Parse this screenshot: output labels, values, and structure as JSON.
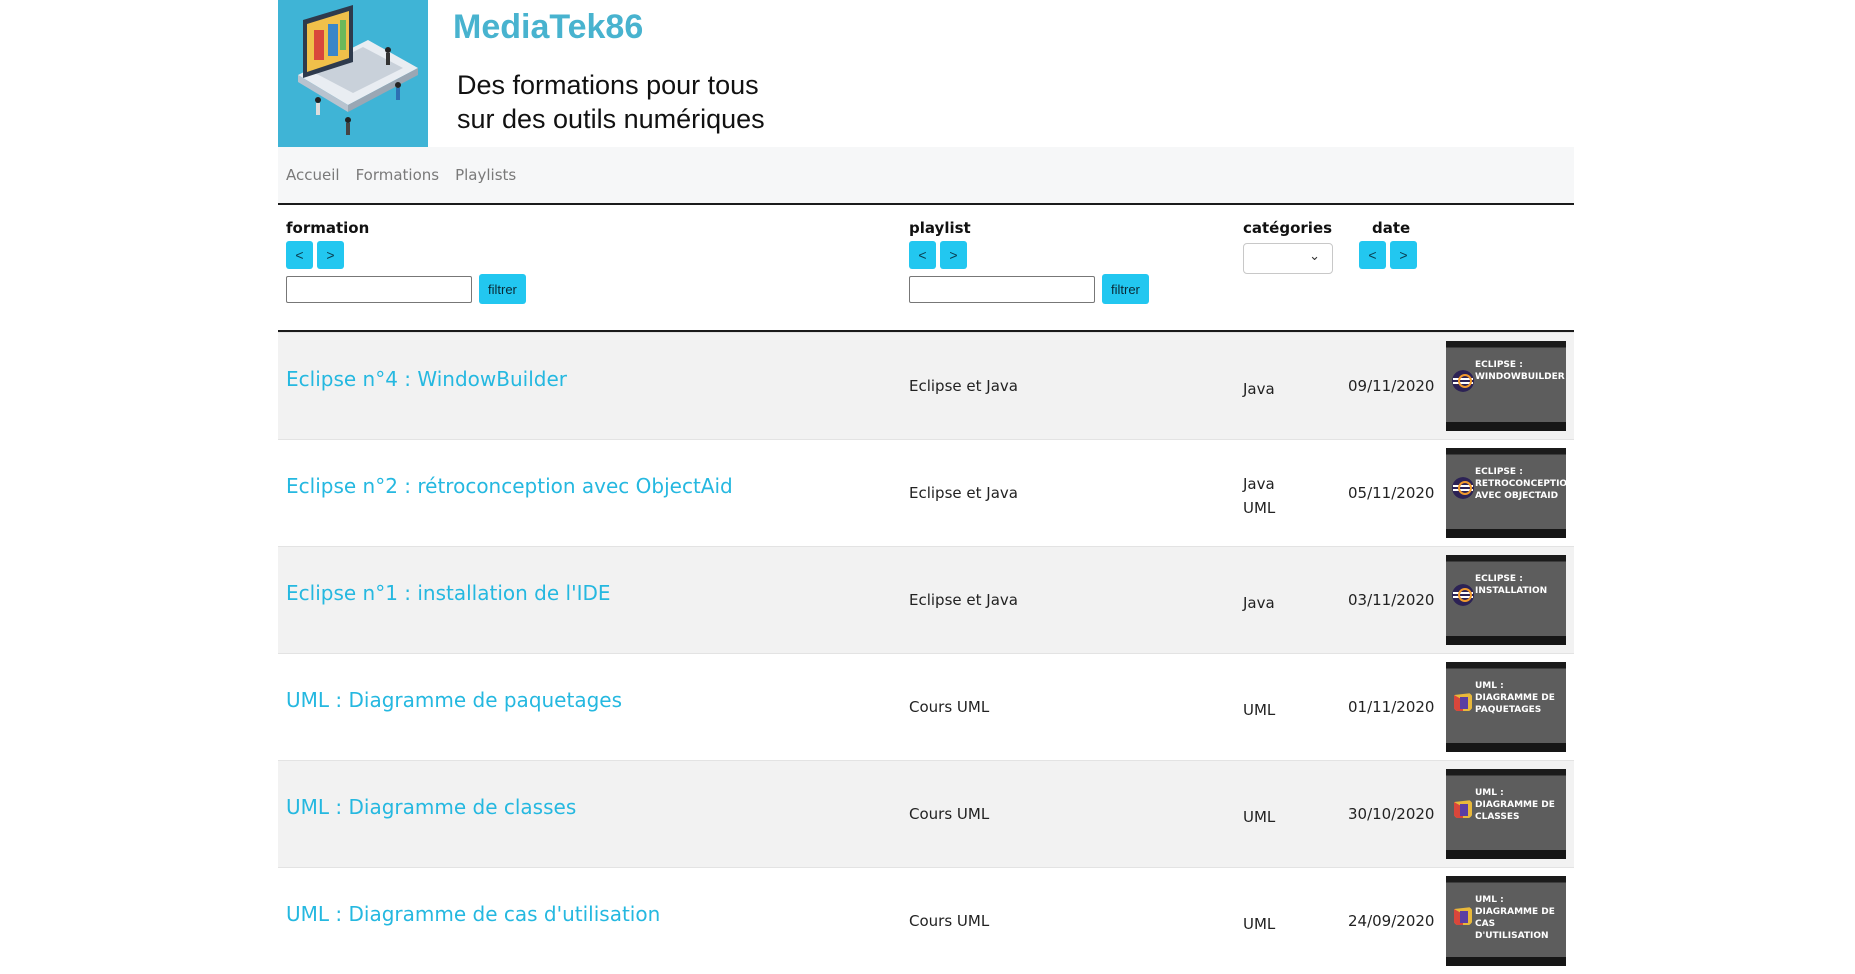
{
  "header": {
    "site_title": "MediaTek86",
    "tagline_line1": "Des formations pour tous",
    "tagline_line2": "sur des outils numériques",
    "logo_bg": "#3fb4d6"
  },
  "nav": {
    "items": [
      {
        "label": "Accueil"
      },
      {
        "label": "Formations"
      },
      {
        "label": "Playlists"
      }
    ]
  },
  "filters": {
    "formation_label": "formation",
    "playlist_label": "playlist",
    "categories_label": "catégories",
    "date_label": "date",
    "sort_asc": "<",
    "sort_desc": ">",
    "filter_button": "filtrer",
    "formation_value": "",
    "playlist_value": "",
    "category_selected": ""
  },
  "rows": [
    {
      "title": "Eclipse n°4 : WindowBuilder",
      "playlist": "Eclipse et Java",
      "categories": [
        "Java"
      ],
      "date": "09/11/2020",
      "thumb_text": "ECLIPSE : WINDOWBUILDER",
      "thumb_icon": "eclipse-icon"
    },
    {
      "title": "Eclipse n°2 : rétroconception avec ObjectAid",
      "playlist": "Eclipse et Java",
      "categories": [
        "Java",
        "UML"
      ],
      "date": "05/11/2020",
      "thumb_text": "ECLIPSE : RETROCONCEPTION AVEC OBJECTAID",
      "thumb_icon": "eclipse-icon"
    },
    {
      "title": "Eclipse n°1 : installation de l'IDE",
      "playlist": "Eclipse et Java",
      "categories": [
        "Java"
      ],
      "date": "03/11/2020",
      "thumb_text": "ECLIPSE : INSTALLATION",
      "thumb_icon": "eclipse-icon"
    },
    {
      "title": "UML : Diagramme de paquetages",
      "playlist": "Cours UML",
      "categories": [
        "UML"
      ],
      "date": "01/11/2020",
      "thumb_text": "UML : DIAGRAMME DE PAQUETAGES",
      "thumb_icon": "uml-4-icon"
    },
    {
      "title": "UML : Diagramme de classes",
      "playlist": "Cours UML",
      "categories": [
        "UML"
      ],
      "date": "30/10/2020",
      "thumb_text": "UML : DIAGRAMME DE CLASSES",
      "thumb_icon": "uml-3-icon"
    },
    {
      "title": "UML : Diagramme de cas d'utilisation",
      "playlist": "Cours UML",
      "categories": [
        "UML"
      ],
      "date": "24/09/2020",
      "thumb_text": "UML : DIAGRAMME DE CAS D'UTILISATION",
      "thumb_icon": "uml-1-icon"
    }
  ],
  "colors": {
    "accent": "#22c7f0",
    "link": "#25b8e0",
    "title": "#48b3cf",
    "row_shade": "#f2f2f2"
  }
}
